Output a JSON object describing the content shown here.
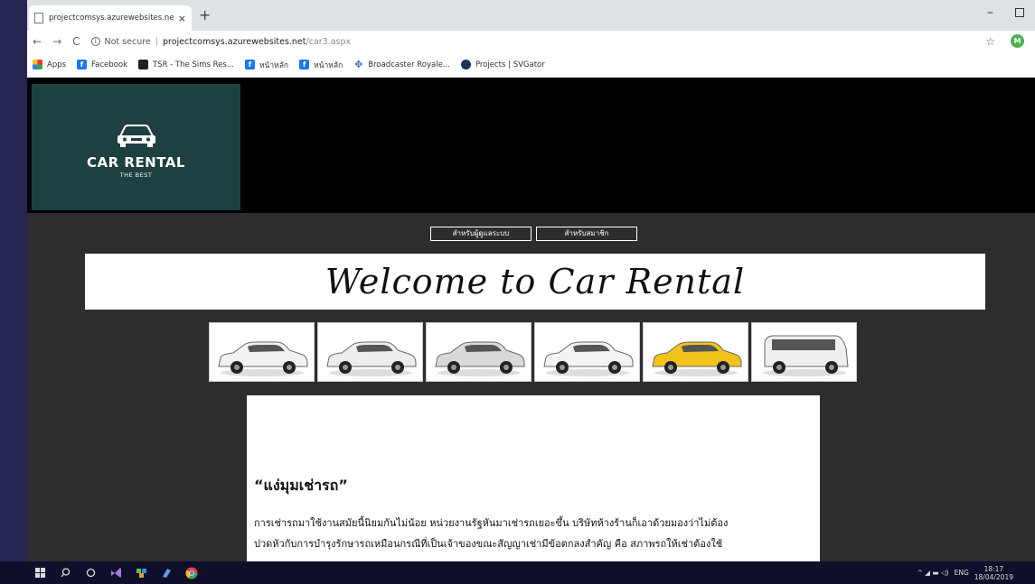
{
  "browser": {
    "tab_title": "projectcomsys.azurewebsites.net",
    "tab_close": "×",
    "new_tab": "+",
    "minimize": "–",
    "security_label": "Not secure",
    "url_host": "projectcomsys.azurewebsites.net",
    "url_path": "/car3.aspx",
    "info_glyph": "i",
    "star": "☆",
    "profile_initial": "M",
    "nav_back": "←",
    "nav_forward": "→",
    "nav_reload": "C",
    "bookmarks": [
      {
        "label": "Apps",
        "icon": "apps-icon"
      },
      {
        "label": "Facebook",
        "icon": "facebook-icon"
      },
      {
        "label": "TSR - The Sims Res...",
        "icon": "tsr-icon"
      },
      {
        "label": "หน้าหลัก",
        "icon": "facebook-icon"
      },
      {
        "label": "หน้าหลัก",
        "icon": "facebook-icon"
      },
      {
        "label": "Broadcaster Royale...",
        "icon": "broadcaster-icon"
      },
      {
        "label": "Projects | SVGator",
        "icon": "svgator-icon"
      }
    ]
  },
  "site": {
    "logo_brand": "CAR RENTAL",
    "logo_tagline": "THE BEST",
    "menu": [
      "สำหรับผู้ดูแลระบบ",
      "สำหรับสมาชิก"
    ],
    "welcome": "Welcome to Car Rental",
    "cars": [
      {
        "name": "white sedan",
        "color": "#f2f2f2"
      },
      {
        "name": "white suv",
        "color": "#ededed"
      },
      {
        "name": "silver suv",
        "color": "#d9d9d9"
      },
      {
        "name": "white compact sedan",
        "color": "#f4f4f4"
      },
      {
        "name": "yellow hatchback",
        "color": "#f2c318"
      },
      {
        "name": "white van",
        "color": "#efefef"
      }
    ],
    "article_title": "“แง่มุมเช่ารถ”",
    "article_lines": [
      "การเช่ารถมาใช้งานสมัยนี้นิยมกันไม่น้อย หน่วยงานรัฐหันมาเช่ารถเยอะขึ้น บริษัทห้างร้านก็เอาด้วยมองว่าไม่ต้อง",
      "ปวดหัวกับการบำรุงรักษารถเหมือนกรณีที่เป็นเจ้าของขณะสัญญาเช่ามีข้อตกลงสำคัญ คือ สภาพรถให้เช่าต้องใช้"
    ]
  },
  "taskbar": {
    "lang": "ENG",
    "time": "18:17",
    "date": "18/04/2019",
    "tray_glyphs": "^  ◢  ▬  ◁)"
  }
}
